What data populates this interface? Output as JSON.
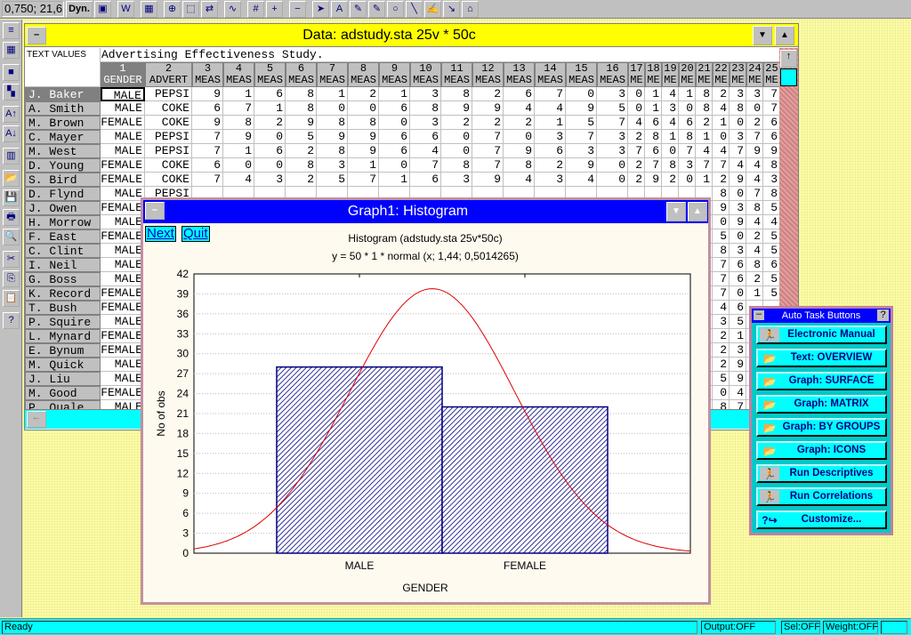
{
  "toolbar": {
    "coord": "0,750; 21,6",
    "dyn": "Dyn.",
    "icons": [
      "graph-window-icon",
      "word-icon",
      "spreadsheet-icon",
      "zoom-lens-icon",
      "select-icon",
      "swap-icon",
      "graph-icon",
      "grid-icon",
      "zoom-in-icon",
      "zoom-out-icon",
      "pointer-icon",
      "text-tool-icon",
      "draw-icon",
      "draw-icon",
      "circle-icon",
      "line-icon",
      "freehand-icon",
      "arrow-icon",
      "camera-icon"
    ]
  },
  "left_toolbar": {
    "icons": [
      "line-style-icon",
      "pattern-icon",
      "yellow-block-icon",
      "blocks-icon",
      "sort-ascending-icon",
      "sort-descending-icon",
      "chart-icon",
      "open-folder-icon",
      "save-disk-icon",
      "printer-icon",
      "print-preview-icon",
      "cut-scissors-icon",
      "copy-icon",
      "paste-icon",
      "help-icon"
    ],
    "glyphs": [
      "≡",
      "▦",
      "■",
      "▚",
      "A↑",
      "A↓",
      "▥",
      "📂",
      "💾",
      "🖶",
      "🔍",
      "✂",
      "⎘",
      "📋",
      "?"
    ]
  },
  "data_window": {
    "title": "Data: adstudy.sta 25v * 50c",
    "corner_label": "TEXT VALUES",
    "file_header": "Advertising Effectiveness Study.",
    "columns": [
      [
        "1",
        "GENDER"
      ],
      [
        "2",
        "ADVERT"
      ],
      [
        "3",
        "MEAS"
      ],
      [
        "4",
        "MEAS"
      ],
      [
        "5",
        "MEAS"
      ],
      [
        "6",
        "MEAS"
      ],
      [
        "7",
        "MEAS"
      ],
      [
        "8",
        "MEAS"
      ],
      [
        "9",
        "MEAS"
      ],
      [
        "10",
        "MEAS"
      ],
      [
        "11",
        "MEAS"
      ],
      [
        "12",
        "MEAS"
      ],
      [
        "13",
        "MEAS"
      ],
      [
        "14",
        "MEAS"
      ],
      [
        "15",
        "MEAS"
      ],
      [
        "16",
        "MEAS"
      ],
      [
        "17",
        "ME"
      ],
      [
        "18",
        "ME"
      ],
      [
        "19",
        "ME"
      ],
      [
        "20",
        "ME"
      ],
      [
        "21",
        "ME"
      ],
      [
        "22",
        "ME"
      ],
      [
        "23",
        "ME"
      ],
      [
        "24",
        "ME"
      ],
      [
        "25",
        "ME"
      ]
    ],
    "rows": [
      {
        "name": "J. Baker",
        "cells": [
          "MALE",
          "PEPSI",
          "9",
          "1",
          "6",
          "8",
          "1",
          "2",
          "1",
          "3",
          "8",
          "2",
          "6",
          "7",
          "0",
          "3",
          "0",
          "1",
          "4",
          "1",
          "8",
          "2",
          "3",
          "3",
          "7"
        ]
      },
      {
        "name": "A. Smith",
        "cells": [
          "MALE",
          "COKE",
          "6",
          "7",
          "1",
          "8",
          "0",
          "0",
          "6",
          "8",
          "9",
          "9",
          "4",
          "4",
          "9",
          "5",
          "0",
          "1",
          "3",
          "0",
          "8",
          "4",
          "8",
          "0",
          "7"
        ]
      },
      {
        "name": "M. Brown",
        "cells": [
          "FEMALE",
          "COKE",
          "9",
          "8",
          "2",
          "9",
          "8",
          "8",
          "0",
          "3",
          "2",
          "2",
          "2",
          "1",
          "5",
          "7",
          "4",
          "6",
          "4",
          "6",
          "2",
          "1",
          "0",
          "2",
          "6"
        ]
      },
      {
        "name": "C. Mayer",
        "cells": [
          "MALE",
          "PEPSI",
          "7",
          "9",
          "0",
          "5",
          "9",
          "9",
          "6",
          "6",
          "0",
          "7",
          "0",
          "3",
          "7",
          "3",
          "2",
          "8",
          "1",
          "8",
          "1",
          "0",
          "3",
          "7",
          "6"
        ]
      },
      {
        "name": "M. West",
        "cells": [
          "MALE",
          "PEPSI",
          "7",
          "1",
          "6",
          "2",
          "8",
          "9",
          "6",
          "4",
          "0",
          "7",
          "9",
          "6",
          "3",
          "3",
          "7",
          "6",
          "0",
          "7",
          "4",
          "4",
          "7",
          "9",
          "9"
        ]
      },
      {
        "name": "D. Young",
        "cells": [
          "FEMALE",
          "COKE",
          "6",
          "0",
          "0",
          "8",
          "3",
          "1",
          "0",
          "7",
          "8",
          "7",
          "8",
          "2",
          "9",
          "0",
          "2",
          "7",
          "8",
          "3",
          "7",
          "7",
          "4",
          "4",
          "8"
        ]
      },
      {
        "name": "S. Bird",
        "cells": [
          "FEMALE",
          "COKE",
          "7",
          "4",
          "3",
          "2",
          "5",
          "7",
          "1",
          "6",
          "3",
          "9",
          "4",
          "3",
          "4",
          "0",
          "2",
          "9",
          "2",
          "0",
          "1",
          "2",
          "9",
          "4",
          "3"
        ]
      },
      {
        "name": "D. Flynd",
        "cells": [
          "MALE",
          "PEPSI",
          "",
          "",
          "",
          "",
          "",
          "",
          "",
          "",
          "",
          "",
          "",
          "",
          "",
          "",
          "",
          "",
          "",
          "",
          "",
          "8",
          "0",
          "7",
          "8"
        ]
      },
      {
        "name": "J. Owen",
        "cells": [
          "FEMALE",
          "",
          "",
          "",
          "",
          "",
          "",
          "",
          "",
          "",
          "",
          "",
          "",
          "",
          "",
          "",
          "",
          "",
          "",
          "",
          "",
          "9",
          "3",
          "8",
          "5"
        ]
      },
      {
        "name": "H. Morrow",
        "cells": [
          "MALE",
          "",
          "",
          "",
          "",
          "",
          "",
          "",
          "",
          "",
          "",
          "",
          "",
          "",
          "",
          "",
          "",
          "",
          "",
          "",
          "",
          "0",
          "9",
          "4",
          "4"
        ]
      },
      {
        "name": "F. East",
        "cells": [
          "FEMALE",
          "",
          "",
          "",
          "",
          "",
          "",
          "",
          "",
          "",
          "",
          "",
          "",
          "",
          "",
          "",
          "",
          "",
          "",
          "",
          "",
          "5",
          "0",
          "2",
          "5"
        ]
      },
      {
        "name": "C. Clint",
        "cells": [
          "MALE",
          "",
          "",
          "",
          "",
          "",
          "",
          "",
          "",
          "",
          "",
          "",
          "",
          "",
          "",
          "",
          "",
          "",
          "",
          "",
          "",
          "8",
          "3",
          "4",
          "5"
        ]
      },
      {
        "name": "I. Neil",
        "cells": [
          "MALE",
          "",
          "",
          "",
          "",
          "",
          "",
          "",
          "",
          "",
          "",
          "",
          "",
          "",
          "",
          "",
          "",
          "",
          "",
          "",
          "",
          "7",
          "6",
          "8",
          "6"
        ]
      },
      {
        "name": "G. Boss",
        "cells": [
          "MALE",
          "",
          "",
          "",
          "",
          "",
          "",
          "",
          "",
          "",
          "",
          "",
          "",
          "",
          "",
          "",
          "",
          "",
          "",
          "",
          "",
          "7",
          "6",
          "2",
          "5"
        ]
      },
      {
        "name": "K. Record",
        "cells": [
          "FEMALE",
          "",
          "",
          "",
          "",
          "",
          "",
          "",
          "",
          "",
          "",
          "",
          "",
          "",
          "",
          "",
          "",
          "",
          "",
          "",
          "",
          "7",
          "0",
          "1",
          "5"
        ]
      },
      {
        "name": "T. Bush",
        "cells": [
          "FEMALE",
          "",
          "",
          "",
          "",
          "",
          "",
          "",
          "",
          "",
          "",
          "",
          "",
          "",
          "",
          "",
          "",
          "",
          "",
          "",
          "",
          "4",
          "6",
          "",
          ""
        ]
      },
      {
        "name": "P. Squire",
        "cells": [
          "MALE",
          "",
          "",
          "",
          "",
          "",
          "",
          "",
          "",
          "",
          "",
          "",
          "",
          "",
          "",
          "",
          "",
          "",
          "",
          "",
          "",
          "3",
          "5",
          "",
          ""
        ]
      },
      {
        "name": "L. Mynard",
        "cells": [
          "FEMALE",
          "",
          "",
          "",
          "",
          "",
          "",
          "",
          "",
          "",
          "",
          "",
          "",
          "",
          "",
          "",
          "",
          "",
          "",
          "",
          "",
          "2",
          "1",
          "",
          ""
        ]
      },
      {
        "name": "E. Bynum",
        "cells": [
          "FEMALE",
          "",
          "",
          "",
          "",
          "",
          "",
          "",
          "",
          "",
          "",
          "",
          "",
          "",
          "",
          "",
          "",
          "",
          "",
          "",
          "",
          "2",
          "3",
          "",
          ""
        ]
      },
      {
        "name": "M. Quick",
        "cells": [
          "MALE",
          "",
          "",
          "",
          "",
          "",
          "",
          "",
          "",
          "",
          "",
          "",
          "",
          "",
          "",
          "",
          "",
          "",
          "",
          "",
          "",
          "2",
          "9",
          "",
          ""
        ]
      },
      {
        "name": "J. Liu",
        "cells": [
          "MALE",
          "",
          "",
          "",
          "",
          "",
          "",
          "",
          "",
          "",
          "",
          "",
          "",
          "",
          "",
          "",
          "",
          "",
          "",
          "",
          "",
          "5",
          "9",
          "",
          ""
        ]
      },
      {
        "name": "M. Good",
        "cells": [
          "FEMALE",
          "",
          "",
          "",
          "",
          "",
          "",
          "",
          "",
          "",
          "",
          "",
          "",
          "",
          "",
          "",
          "",
          "",
          "",
          "",
          "",
          "0",
          "4",
          "",
          ""
        ]
      },
      {
        "name": "P. Quale",
        "cells": [
          "MALE",
          "",
          "",
          "",
          "",
          "",
          "",
          "",
          "",
          "",
          "",
          "",
          "",
          "",
          "",
          "",
          "",
          "",
          "",
          "",
          "",
          "8",
          "7",
          "",
          ""
        ]
      }
    ]
  },
  "graph_window": {
    "title": "Graph1: Histogram",
    "next_label": "Next",
    "quit_label": "Quit",
    "chart_data": {
      "type": "bar",
      "title": "Histogram (adstudy.sta 25v*50c)",
      "subtitle": "y = 50 * 1 * normal (x; 1,44; 0,5014265)",
      "xlabel": "GENDER",
      "ylabel": "No of obs",
      "categories": [
        "MALE",
        "FEMALE"
      ],
      "values": [
        28,
        22
      ],
      "ylim": [
        0,
        42
      ],
      "yticks": [
        "0",
        "3",
        "6",
        "9",
        "12",
        "15",
        "18",
        "21",
        "24",
        "27",
        "30",
        "33",
        "36",
        "39",
        "42"
      ],
      "grid": true,
      "fit_curve": {
        "type": "normal",
        "n": 50,
        "mean": 1.44,
        "sd": 0.5014265,
        "color": "#e00000"
      },
      "bar_color": "#000080"
    }
  },
  "auto_tasks": {
    "title": "Auto Task Buttons",
    "help": "?",
    "buttons": [
      {
        "label": "Electronic Manual",
        "icon": "runner-icon"
      },
      {
        "label": "Text: OVERVIEW",
        "icon": "folder-icon"
      },
      {
        "label": "Graph: SURFACE",
        "icon": "folder-icon"
      },
      {
        "label": "Graph: MATRIX",
        "icon": "folder-icon"
      },
      {
        "label": "Graph: BY GROUPS",
        "icon": "folder-icon"
      },
      {
        "label": "Graph: ICONS",
        "icon": "folder-icon"
      },
      {
        "label": "Run Descriptives",
        "icon": "runner-icon"
      },
      {
        "label": "Run Correlations",
        "icon": "runner-icon"
      },
      {
        "label": "Customize...",
        "icon": "customize-icon"
      }
    ]
  },
  "status": {
    "text": "Ready",
    "output": "Output:OFF",
    "sel": "Sel:OFF",
    "weight": "Weight:OFF"
  }
}
